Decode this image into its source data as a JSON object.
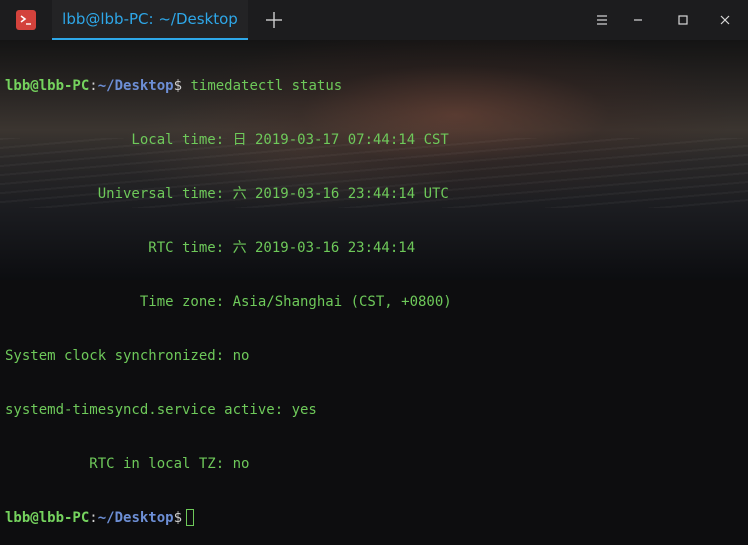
{
  "window": {
    "tab_title": "lbb@lbb-PC: ~/Desktop",
    "icons": {
      "app": "terminal-icon",
      "new_tab": "plus-icon",
      "menu": "menu-icon",
      "minimize": "minimize-icon",
      "maximize": "maximize-icon",
      "close": "close-icon"
    }
  },
  "terminal": {
    "prompt_user": "lbb@lbb-PC",
    "prompt_sep": ":",
    "prompt_path": "~/Desktop",
    "prompt_sym": "$",
    "command": "timedatectl status",
    "output": [
      "               Local time: 日 2019-03-17 07:44:14 CST",
      "           Universal time: 六 2019-03-16 23:44:14 UTC",
      "                 RTC time: 六 2019-03-16 23:44:14",
      "                Time zone: Asia/Shanghai (CST, +0800)",
      "System clock synchronized: no",
      "systemd-timesyncd.service active: yes",
      "          RTC in local TZ: no"
    ]
  },
  "colors": {
    "accent": "#2ea7e8",
    "prompt_green": "#75d35e",
    "path_blue": "#6d8fd6",
    "text_green": "#6ec95a",
    "app_icon_red": "#d3423c"
  }
}
